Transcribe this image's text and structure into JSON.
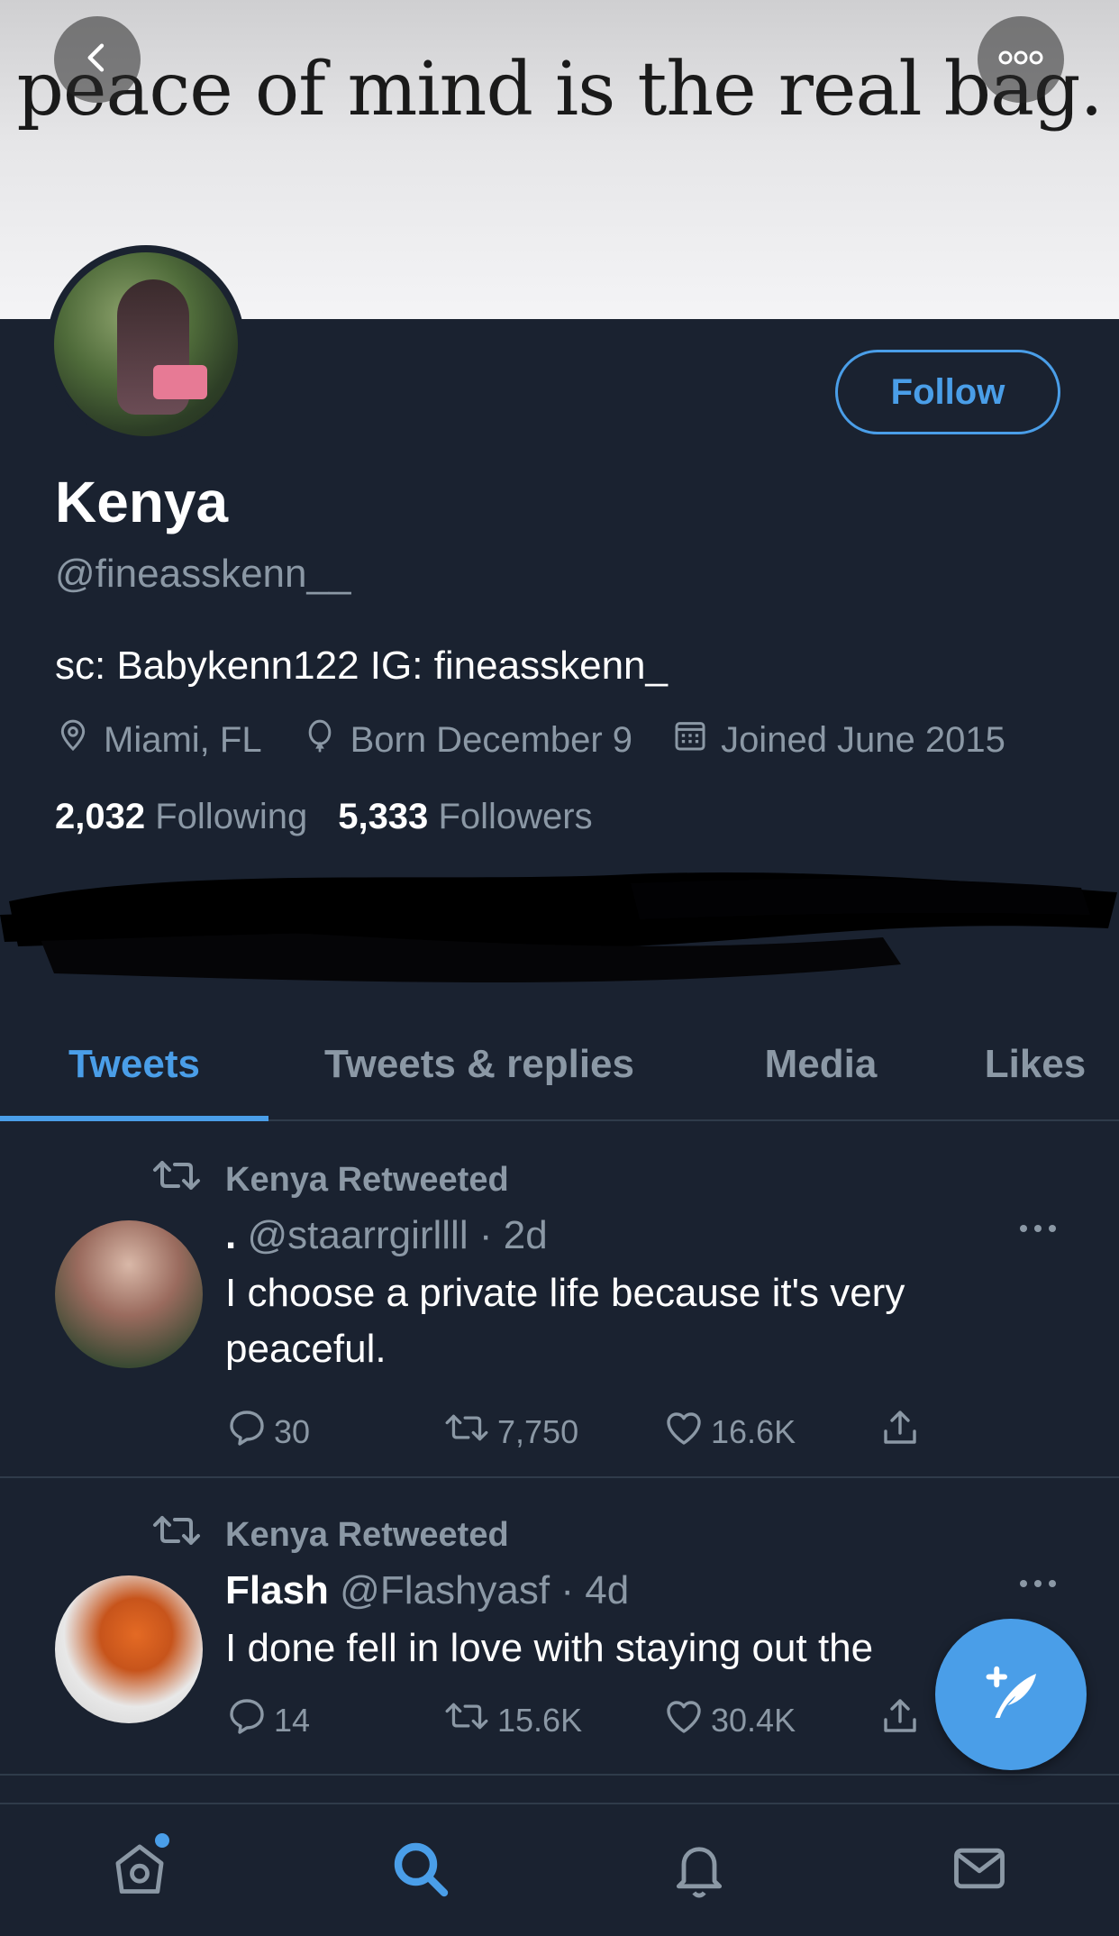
{
  "banner": {
    "text": "peace of mind is the real bag."
  },
  "profile": {
    "follow_label": "Follow",
    "name": "Kenya",
    "handle": "@fineasskenn__",
    "bio": "sc: Babykenn122 IG: fineasskenn_",
    "location": "Miami, FL",
    "birthday": "Born December 9",
    "joined": "Joined June 2015",
    "following_count": "2,032",
    "following_label": "Following",
    "followers_count": "5,333",
    "followers_label": "Followers"
  },
  "tabs": [
    {
      "label": "Tweets",
      "active": true
    },
    {
      "label": "Tweets & replies",
      "active": false
    },
    {
      "label": "Media",
      "active": false
    },
    {
      "label": "Likes",
      "active": false
    }
  ],
  "tweets": [
    {
      "retweeted_by": "Kenya Retweeted",
      "display_name": ".",
      "handle": "@staarrgirllll",
      "time": "2d",
      "text": "I choose a private life because it's very peaceful.",
      "replies": "30",
      "retweets": "7,750",
      "likes": "16.6K"
    },
    {
      "retweeted_by": "Kenya Retweeted",
      "display_name": "Flash",
      "handle": "@Flashyasf",
      "time": "4d",
      "text": "I done fell in love with staying out the",
      "replies": "14",
      "retweets": "15.6K",
      "likes": "30.4K"
    }
  ],
  "colors": {
    "accent": "#4a9ee8",
    "background": "#1a2230",
    "muted_text": "#8b98a5"
  },
  "icons": {
    "back": "chevron-left-icon",
    "more": "more-horizontal-icon",
    "location": "location-pin-icon",
    "birthday": "balloon-icon",
    "joined": "calendar-icon",
    "retweet": "retweet-icon",
    "reply": "reply-icon",
    "like": "heart-icon",
    "share": "share-icon",
    "compose": "compose-tweet-icon",
    "home": "home-icon",
    "search": "search-icon",
    "notifications": "bell-icon",
    "messages": "mail-icon"
  }
}
